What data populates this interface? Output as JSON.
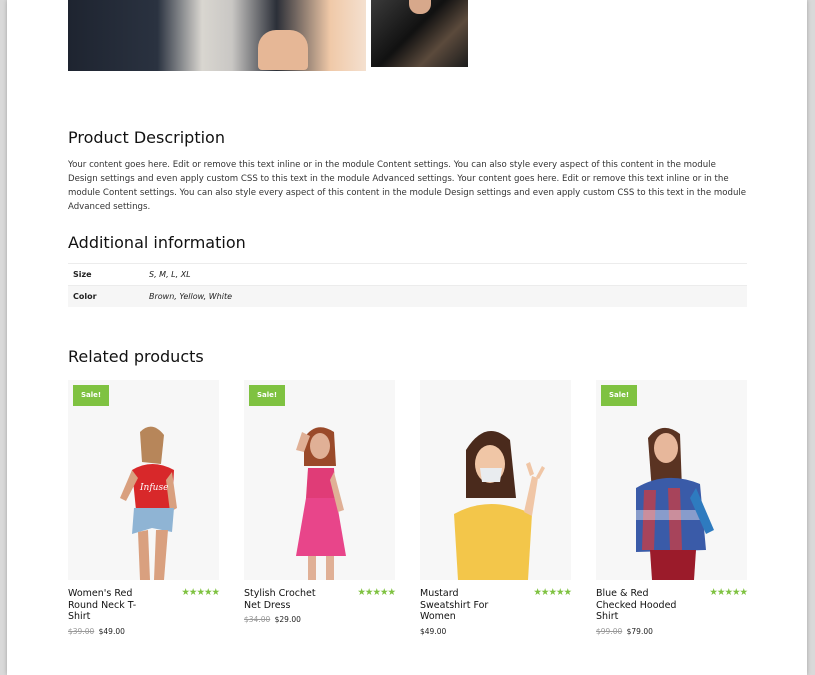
{
  "description": {
    "heading": "Product Description",
    "text": "Your content goes here. Edit or remove this text inline or in the module Content settings. You can also style every aspect of this content in the module Design settings and even apply custom CSS to this text in the module Advanced settings. Your content goes here. Edit or remove this text inline or in the module Content settings. You can also style every aspect of this content in the module Design settings and even apply custom CSS to this text in the module Advanced settings."
  },
  "additional": {
    "heading": "Additional information",
    "rows": [
      {
        "label": "Size",
        "value": "S, M, L, XL"
      },
      {
        "label": "Color",
        "value": "Brown, Yellow, White"
      }
    ]
  },
  "related": {
    "heading": "Related products",
    "products": [
      {
        "name": "Women's Red Round Neck T-Shirt",
        "old_price": "$39.00",
        "price": "$49.00",
        "sale": "Sale!",
        "stars": "★★★★★"
      },
      {
        "name": "Stylish Crochet Net Dress",
        "old_price": "$34.00",
        "price": "$29.00",
        "sale": "Sale!",
        "stars": "★★★★★"
      },
      {
        "name": "Mustard Sweatshirt For Women",
        "old_price": "",
        "price": "$49.00",
        "sale": "",
        "stars": "★★★★★"
      },
      {
        "name": "Blue & Red Checked Hooded Shirt",
        "old_price": "$99.00",
        "price": "$79.00",
        "sale": "Sale!",
        "stars": "★★★★★"
      }
    ]
  },
  "colors": {
    "accent": "#7fc241"
  }
}
